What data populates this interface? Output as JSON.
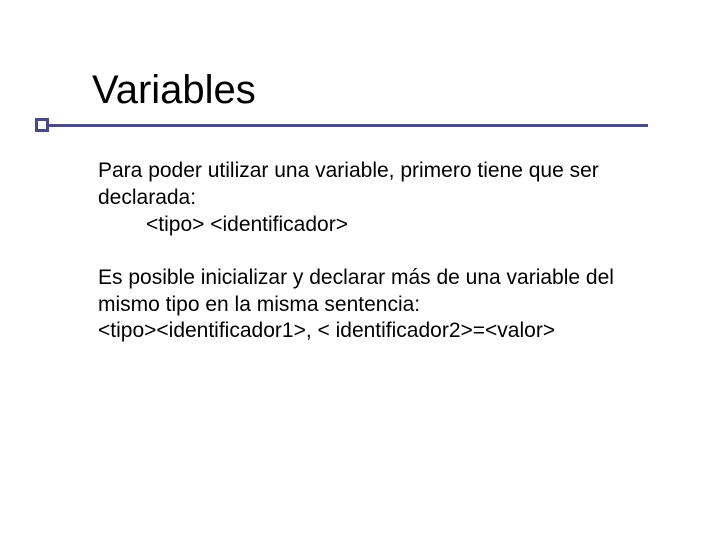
{
  "title": "Variables",
  "body": {
    "p1": {
      "intro": "Para poder utilizar una variable, primero tiene que ser declarada:",
      "syntax": "<tipo> <identificador>"
    },
    "p2": {
      "intro": "Es posible inicializar y declarar más de una variable del mismo tipo en la misma sentencia:",
      "syntax": "<tipo><identificador1>, < identificador2>=<valor>"
    }
  }
}
